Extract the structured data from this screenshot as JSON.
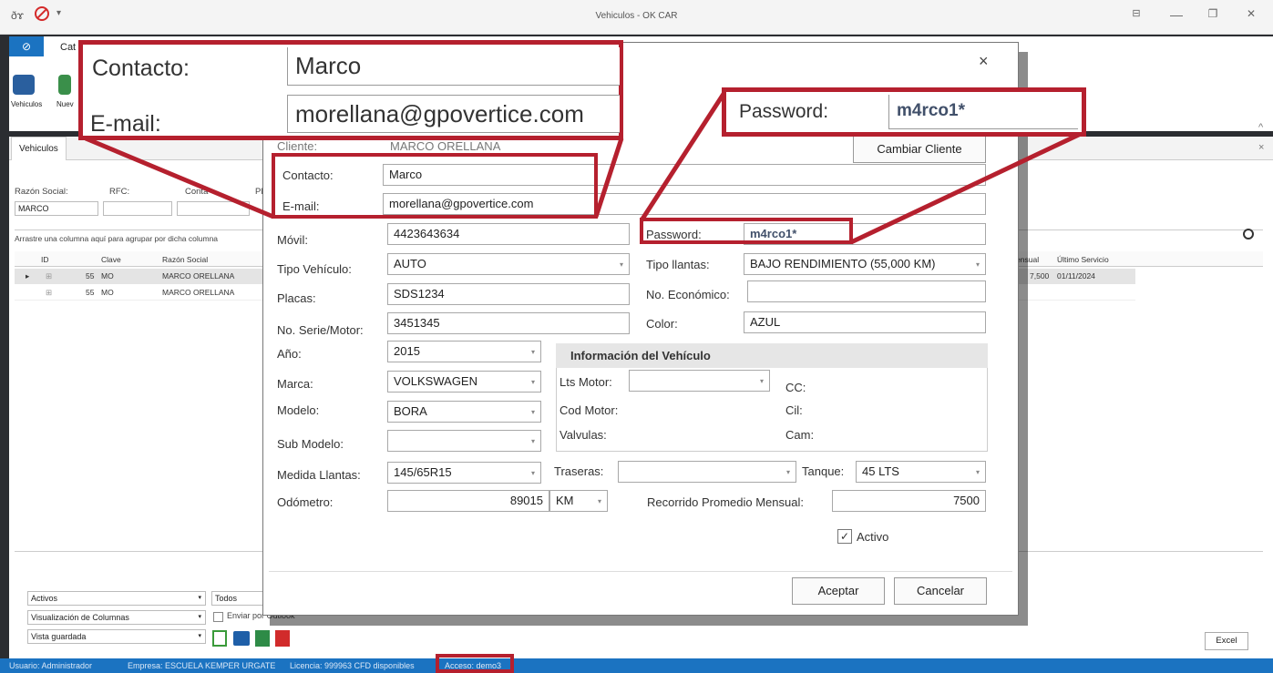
{
  "window": {
    "title": "Vehiculos - OK CAR",
    "qat": {
      "app_icon": "key-icon",
      "separator": "v",
      "stop_icon": "no-entry-icon",
      "dropdown": "▾"
    },
    "controls": {
      "restore": "⊟",
      "minimize": "—",
      "maximize": "❐",
      "close": "✕"
    }
  },
  "ribbon": {
    "menu_icon": "⊘",
    "tab_label": "Cat",
    "buttons": [
      {
        "label": "Vehiculos",
        "icon": "car-icon"
      },
      {
        "label": "Nuev",
        "icon": "new-vehicle-icon"
      }
    ],
    "collapse": "^"
  },
  "doc_tabs": {
    "active": "Vehiculos",
    "close": "×"
  },
  "filters": {
    "razon_label": "Razón Social:",
    "rfc_label": "RFC:",
    "contacto_label": "Conta",
    "pl_label": "Pl",
    "razon_value": "MARCO"
  },
  "grid": {
    "group_hint": "Arrastre una columna aquí para agrupar por dicha columna",
    "search_icon": "magnifier-icon",
    "columns_left": [
      "ID",
      "Clave",
      "Razón Social"
    ],
    "columns_right": [
      "Mensual",
      "Último Servicio"
    ],
    "rows": [
      {
        "clave": "55",
        "code": "MO",
        "razon": "MARCO ORELLANA",
        "mensual": "7,500",
        "ultimo": "01/11/2024"
      },
      {
        "clave": "55",
        "code": "MO",
        "razon": "MARCO ORELLANA",
        "mensual": "",
        "ultimo": ""
      }
    ]
  },
  "bottom": {
    "activos": "Activos",
    "todos": "Todos",
    "visualizacion": "Visualización de Columnas",
    "enviar_outlook": "Enviar por Outlook",
    "vista": "Vista guardada",
    "excel_button": "Excel"
  },
  "statusbar": {
    "usuario": "Usuario: Administrador",
    "empresa": "Empresa: ESCUELA KEMPER URGATE",
    "licencia": "Licencia: 999963 CFD disponibles",
    "acceso": "Acceso: demo3"
  },
  "dialog": {
    "close": "×",
    "cliente_label": "Cliente:",
    "cliente_value": "MARCO ORELLANA",
    "cambiar_cliente": "Cambiar Cliente",
    "contacto_label": "Contacto:",
    "contacto_value": "Marco",
    "email_label": "E-mail:",
    "email_value": "morellana@gpovertice.com",
    "movil_label": "Móvil:",
    "movil_value": "4423643634",
    "password_label": "Password:",
    "password_value": "m4rco1*",
    "tipo_vehiculo_label": "Tipo Vehículo:",
    "tipo_vehiculo_value": "AUTO",
    "tipo_llantas_label": "Tipo llantas:",
    "tipo_llantas_value": "BAJO RENDIMIENTO (55,000 KM)",
    "placas_label": "Placas:",
    "placas_value": "SDS1234",
    "no_economico_label": "No. Económico:",
    "no_economico_value": "",
    "serie_label": "No. Serie/Motor:",
    "serie_value": "3451345",
    "color_label": "Color:",
    "color_value": "AZUL",
    "anio_label": "Año:",
    "anio_value": "2015",
    "marca_label": "Marca:",
    "marca_value": "VOLKSWAGEN",
    "modelo_label": "Modelo:",
    "modelo_value": "BORA",
    "submodelo_label": "Sub Modelo:",
    "submodelo_value": "",
    "info_header": "Información del Vehículo",
    "lts_motor_label": "Lts Motor:",
    "cod_motor_label": "Cod Motor:",
    "valvulas_label": "Valvulas:",
    "cc_label": "CC:",
    "cil_label": "Cil:",
    "cam_label": "Cam:",
    "medida_llantas_label": "Medida Llantas:",
    "medida_llantas_value": "145/65R15",
    "traseras_label": "Traseras:",
    "traseras_value": "",
    "tanque_label": "Tanque:",
    "tanque_value": "45 LTS",
    "odometro_label": "Odómetro:",
    "odometro_value": "89015",
    "odometro_unit": "KM",
    "recorrido_label": "Recorrido Promedio Mensual:",
    "recorrido_value": "7500",
    "activo_label": "Activo",
    "activo_checked": "✓",
    "aceptar": "Aceptar",
    "cancelar": "Cancelar"
  },
  "callouts": {
    "contacto_label": "Contacto:",
    "contacto_value": "Marco",
    "email_label": "E-mail:",
    "email_value": "morellana@gpovertice.com",
    "password_label": "Password:",
    "password_value": "m4rco1*"
  },
  "colors": {
    "accent": "#1b73c1",
    "highlight": "#b5202e"
  }
}
